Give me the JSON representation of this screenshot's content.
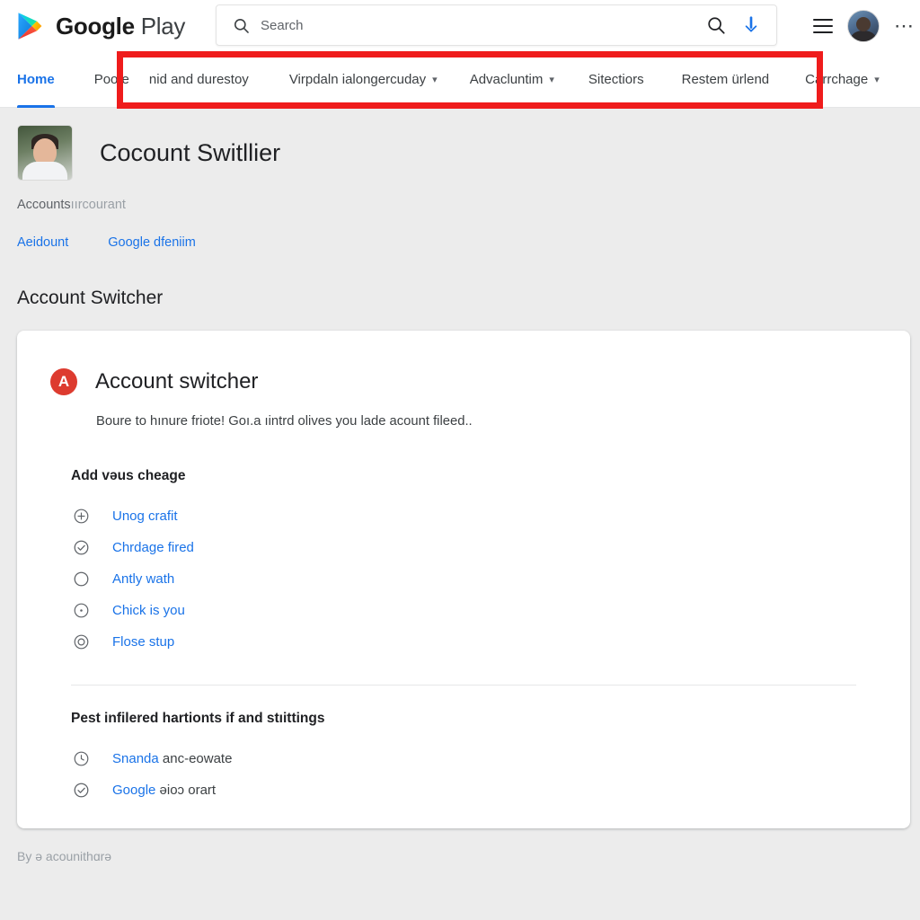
{
  "header": {
    "brand_google": "Google",
    "brand_play": "Play",
    "logo_icon": "google-play-triangle-logo",
    "search": {
      "placeholder": "Search",
      "value": "",
      "lead_icon": "search-icon",
      "submit_icon": "search-icon",
      "download_icon": "download-arrow-icon"
    },
    "menu_icon": "hamburger-menu-icon",
    "avatar_icon": "user-avatar",
    "overflow_icon": "more-options-dots-icon"
  },
  "nav": {
    "items": [
      {
        "label": "Home",
        "active": true,
        "caret": false
      },
      {
        "label": "Poote",
        "active": false,
        "caret": false
      },
      {
        "label": "nid and durestoy",
        "active": false,
        "caret": false
      },
      {
        "label": "Virpdaln ialongercuday",
        "active": false,
        "caret": true
      },
      {
        "label": "Advacluntim",
        "active": false,
        "caret": true
      },
      {
        "label": "Sitectiors",
        "active": false,
        "caret": false
      },
      {
        "label": "Restem ürlend",
        "active": false,
        "caret": false
      },
      {
        "label": "Carrchage",
        "active": false,
        "caret": true
      }
    ],
    "caret_icon": "chevron-down-icon",
    "highlight_color": "#ef1c1c",
    "active_color": "#1a73e8"
  },
  "profile": {
    "avatar_icon": "profile-photo",
    "name": "Cocount Switllier",
    "meta_prefix": "Accounts",
    "meta_suffix": "ıırcourant",
    "links": [
      {
        "label": "Aeidount"
      },
      {
        "label": "Google dfeniim"
      }
    ]
  },
  "page_section": {
    "title": "Account Switcher"
  },
  "card": {
    "badge_letter": "A",
    "badge_color": "#dd3b2f",
    "title": "Account switcher",
    "subtitle": "Boure to hınure friote! Goı.a ıintrd olives you lade acount fileed..",
    "group1": {
      "label": "Add vəus cheage",
      "items": [
        {
          "label": "Unog crafit",
          "icon": "plus-circle-icon"
        },
        {
          "label": "Chrdage fired",
          "icon": "check-circle-icon"
        },
        {
          "label": "Antly wath",
          "icon": "empty-circle-icon"
        },
        {
          "label": "Chick is you",
          "icon": "dot-circle-icon"
        },
        {
          "label": "Flose stup",
          "icon": "target-circle-icon"
        }
      ]
    },
    "group2": {
      "label": "Pest infilered hartionts if and stıittings",
      "items": [
        {
          "label": "Snanda",
          "label_grey": " anc-eowate",
          "icon": "clock-circle-icon"
        },
        {
          "label": "Google",
          "label_grey": " əioɔ orart",
          "icon": "check-circle-icon"
        }
      ]
    }
  },
  "footer": {
    "note": "By ə acounithɑrə"
  }
}
